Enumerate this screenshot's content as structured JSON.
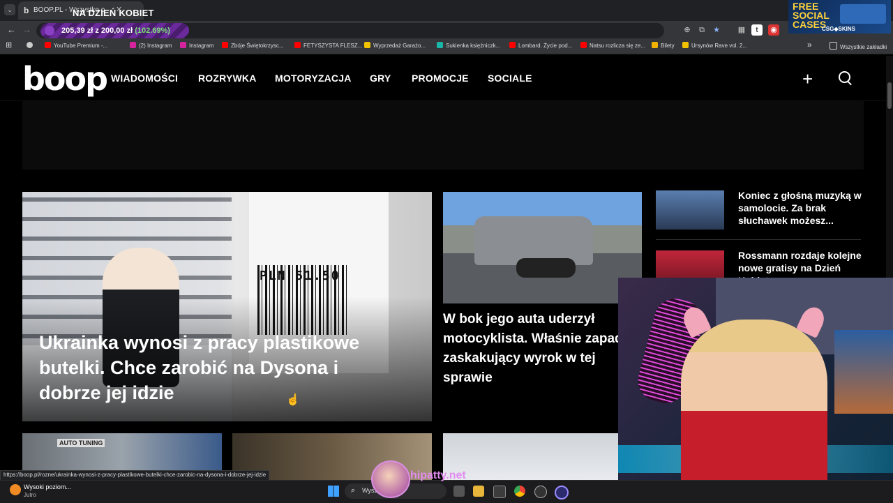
{
  "browser": {
    "tab_title": "BOOP.PL - Wszystko o  ",
    "tab_icon": "b",
    "overlay_banner": "NA DZIEŃ KOBIET",
    "promo_text": "205,39 zł z 200,00 zł",
    "promo_percent": "(102.69%)",
    "extensions_ad": {
      "line1": "FREE SOCIAL CASES",
      "line2": "CSG◆SKINS"
    },
    "bookmarks": [
      {
        "label": "YouTube Premium -...",
        "color": "#ff0000"
      },
      {
        "label": "(2) Instagram",
        "color": "#d6249f"
      },
      {
        "label": "Instagram",
        "color": "#d6249f"
      },
      {
        "label": "Zbóje Świętokrzysc...",
        "color": "#ff0000"
      },
      {
        "label": "FETYSZYSTA FLESZ...",
        "color": "#ff0000"
      },
      {
        "label": "Wyprzedaż Garażo...",
        "color": "#f2c200"
      },
      {
        "label": "Sukienka księżniczk...",
        "color": "#1ab7a8"
      },
      {
        "label": "Lombard. Życie pod...",
        "color": "#ff0000"
      },
      {
        "label": "Natsu rozlicza się ze...",
        "color": "#ff0000"
      },
      {
        "label": "Bilety",
        "color": "#f2b300"
      },
      {
        "label": "Ursynów Rave vol. 2...",
        "color": "#f2c200"
      }
    ],
    "all_bookmarks": "Wszystkie zakładki",
    "chevron": "»"
  },
  "site": {
    "logo": "boop",
    "nav": [
      "WIADOMOŚCI",
      "ROZRYWKA",
      "MOTORYZACJA",
      "GRY",
      "PROMOCJE",
      "SOCIALE"
    ],
    "plus": "+"
  },
  "articles": {
    "hero": {
      "title": "Ukrainka wynosi z pracy plastikowe butelki. Chce zarobić na Dysona i dobrze jej idzie",
      "price_tag": "PLN 51.50"
    },
    "second": {
      "title": "W bok jego auta uderzył motocyklista. Właśnie zapadł zaskakujący wyrok w tej sprawie"
    },
    "side": [
      {
        "title": "Koniec z głośną muzyką w samolocie. Za brak słuchawek możesz..."
      },
      {
        "title": "Rossmann rozdaje kolejne nowe gratisy na Dzień Kobiet"
      }
    ],
    "row2_label": "AUTO TUNING"
  },
  "status_url": "https://boop.pl/rozne/ukrainka-wynosi-z-pracy-plastikowe-butelki-chce-zarobic-na-dysona-i-dobrze-jej-idzie",
  "taskbar": {
    "weather_title": "Wysoki poziom...",
    "weather_sub": "Jutro",
    "search": "Wysz",
    "streamer_tag": "hipatty.net"
  }
}
